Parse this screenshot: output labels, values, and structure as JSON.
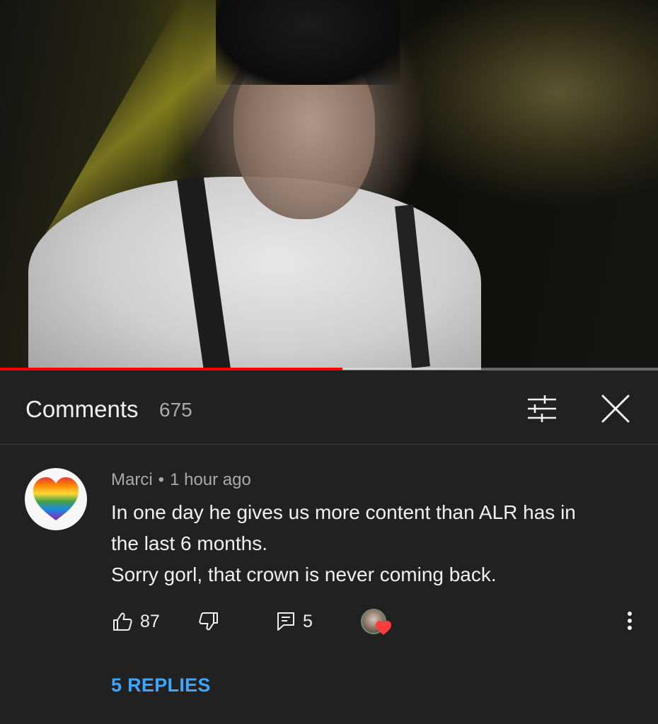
{
  "video": {
    "progress_fraction": 0.52
  },
  "comments_panel": {
    "title": "Comments",
    "count": "675",
    "sort_icon": "sort-filter-icon",
    "close_icon": "close-icon"
  },
  "comment": {
    "author": "Marci",
    "separator": "•",
    "time": "1 hour ago",
    "text_lines": [
      "In one day he gives us more content than ALR has in",
      "the last 6 months.",
      "Sorry gorl, that crown is never coming back."
    ],
    "likes": "87",
    "replies_count": "5",
    "replies_link": "5 REPLIES",
    "icons": {
      "like": "thumbs-up-icon",
      "dislike": "thumbs-down-icon",
      "reply": "reply-icon",
      "hearted": "creator-heart-icon",
      "more": "more-vert-icon"
    },
    "colors": {
      "link": "#3ea6ff",
      "heart": "#ff3b3b",
      "progress": "#ff0000"
    }
  }
}
